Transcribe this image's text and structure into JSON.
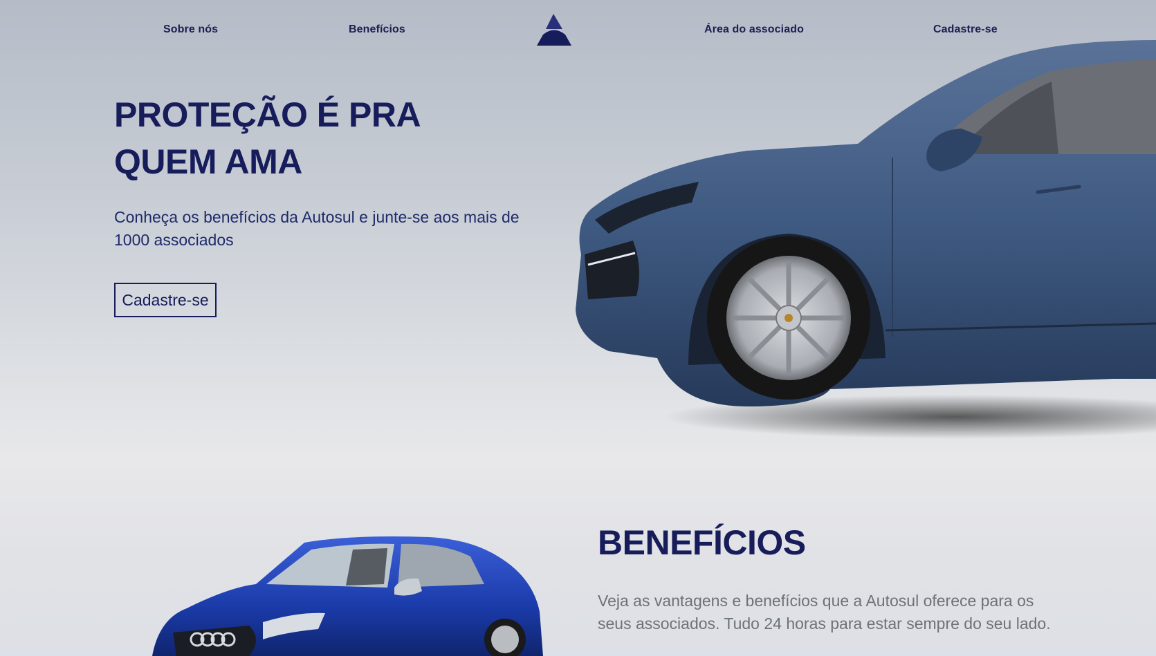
{
  "nav": {
    "items": [
      "Sobre nós",
      "Benefícios",
      "Área do associado",
      "Cadastre-se"
    ]
  },
  "hero": {
    "title_line1": "PROTEÇÃO É PRA",
    "title_line2": "QUEM AMA",
    "subtitle": "Conheça os benefícios da Autosul e junte-se aos mais de 1000 associados",
    "cta_label": "Cadastre-se"
  },
  "benefits": {
    "title": "BENEFÍCIOS",
    "text": "Veja as vantagens e benefícios que a Autosul oferece para os seus associados. Tudo 24 horas para estar sempre do seu lado."
  },
  "colors": {
    "brand_navy": "#171c5b",
    "suv_body": "#3f5a82",
    "sedan_body": "#1a3aa8"
  },
  "icons": {
    "logo": "autosul-triangle-logo"
  }
}
